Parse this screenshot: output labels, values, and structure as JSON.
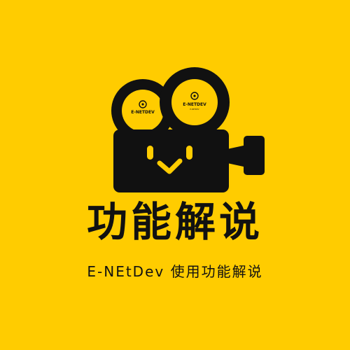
{
  "logo": {
    "reel_left_text": "E-NETDEV",
    "reel_right_text": "E-NETDEV",
    "reel_right_subtext": "E-NETDEV",
    "icon": "video-camera-icon",
    "colors": {
      "background": "#FFCC00",
      "ink": "#111111"
    }
  },
  "title": "功能解说",
  "subtitle": "E-NEtDev 使用功能解说"
}
